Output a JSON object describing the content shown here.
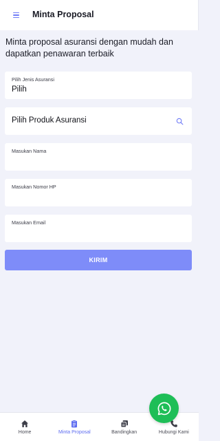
{
  "header": {
    "title": "Minta Proposal",
    "menu_icon": "hamburger-icon"
  },
  "intro_text": "Minta proposal asuransi dengan mudah dan dapatkan penawaran terbaik",
  "form": {
    "insurance_type": {
      "label": "Pilih Jenis Asuransi",
      "value": "Pilih"
    },
    "insurance_product": {
      "placeholder": "Pilih Produk Asuransi",
      "icon": "search-icon"
    },
    "name": {
      "label": "Masukan Nama",
      "value": ""
    },
    "phone": {
      "label": "Masukan Nomor HP",
      "value": ""
    },
    "email": {
      "label": "Masukan Email",
      "value": ""
    },
    "submit_label": "KIRIM"
  },
  "whatsapp": {
    "icon": "whatsapp-icon"
  },
  "bottom_nav": {
    "items": [
      {
        "label": "Home",
        "icon": "home-icon",
        "active": false
      },
      {
        "label": "Minta Proposal",
        "icon": "clipboard-icon",
        "active": true
      },
      {
        "label": "Bandingkan",
        "icon": "compare-icon",
        "active": false
      },
      {
        "label": "Hubungi Kami",
        "icon": "phone-icon",
        "active": false
      }
    ]
  },
  "colors": {
    "accent": "#5c6bf0",
    "button": "#7e8cf9",
    "background": "#f1f2fa",
    "whatsapp": "#1ebe57"
  }
}
